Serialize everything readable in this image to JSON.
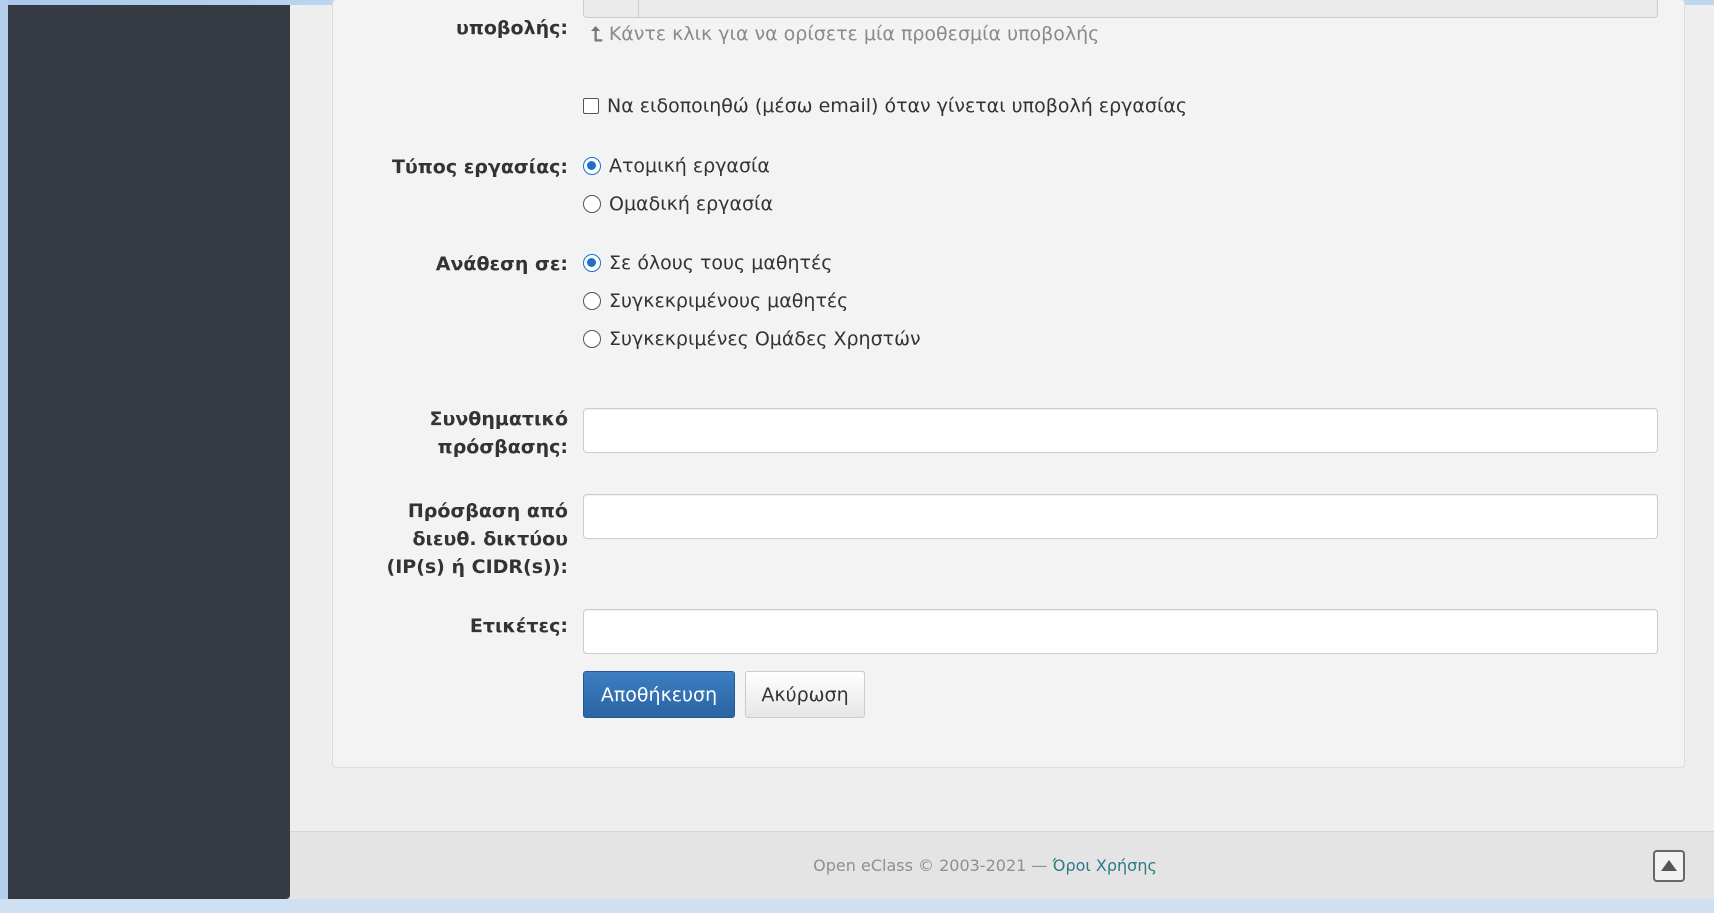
{
  "form": {
    "deadline_label": "υποβολής:",
    "deadline_hint": "Κάντε κλικ για να ορίσετε μία προθεσμία υποβολής",
    "notify_label": "Να ειδοποιηθώ (μέσω email) όταν γίνεται υποβολή εργασίας",
    "notify_checked": false,
    "type_label": "Τύπος εργασίας:",
    "type_options": [
      "Ατομική εργασία",
      "Ομαδική εργασία"
    ],
    "type_selected": "Ατομική εργασία",
    "assign_label": "Ανάθεση σε:",
    "assign_options": [
      "Σε όλους τους μαθητές",
      "Συγκεκριμένους μαθητές",
      "Συγκεκριμένες Ομάδες Χρηστών"
    ],
    "assign_selected": "Σε όλους τους μαθητές",
    "password_label_line1": "Συνθηματικό",
    "password_label_line2": "πρόσβασης:",
    "password_value": "",
    "ip_label_line1": "Πρόσβαση από",
    "ip_label_line2": "διευθ. δικτύου",
    "ip_label_line3": "(IP(s) ή CIDR(s)):",
    "ip_value": "",
    "tags_label": "Ετικέτες:",
    "tags_value": "",
    "save_label": "Αποθήκευση",
    "cancel_label": "Ακύρωση"
  },
  "footer": {
    "copyright": "Open eClass © 2003-2021 — ",
    "terms_link": "Όροι Χρήσης"
  },
  "colors": {
    "accent": "#1f6fd1",
    "primary_button": "#2f6eb0",
    "sidebar": "#363a42",
    "link": "#2b7a86"
  },
  "icons": {
    "hint": "arrow-up-curved-icon",
    "scroll_top": "scroll-to-top-icon"
  }
}
